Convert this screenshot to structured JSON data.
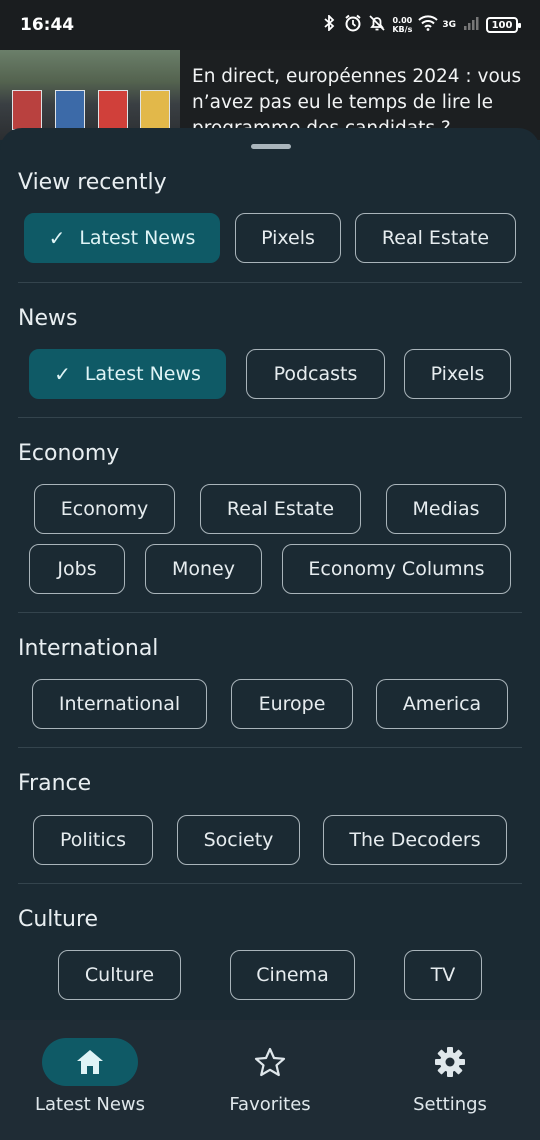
{
  "status_bar": {
    "time": "16:44",
    "speed_value": "0.00",
    "speed_unit": "KB/s",
    "network": "3G",
    "battery": "100"
  },
  "article": {
    "headline": "En direct, européennes 2024 : vous n’avez pas eu le temps de lire le programme des candidats ?"
  },
  "sections": [
    {
      "title": "View recently",
      "chips": [
        {
          "label": "Latest News",
          "selected": true
        },
        {
          "label": "Pixels",
          "selected": false
        },
        {
          "label": "Real Estate",
          "selected": false
        }
      ]
    },
    {
      "title": "News",
      "chips": [
        {
          "label": "Latest News",
          "selected": true
        },
        {
          "label": "Podcasts",
          "selected": false
        },
        {
          "label": "Pixels",
          "selected": false
        }
      ]
    },
    {
      "title": "Economy",
      "chips": [
        {
          "label": "Economy",
          "selected": false
        },
        {
          "label": "Real Estate",
          "selected": false
        },
        {
          "label": "Medias",
          "selected": false
        },
        {
          "label": "Jobs",
          "selected": false
        },
        {
          "label": "Money",
          "selected": false
        },
        {
          "label": "Economy Columns",
          "selected": false
        }
      ]
    },
    {
      "title": "International",
      "chips": [
        {
          "label": "International",
          "selected": false
        },
        {
          "label": "Europe",
          "selected": false
        },
        {
          "label": "America",
          "selected": false
        }
      ]
    },
    {
      "title": "France",
      "chips": [
        {
          "label": "Politics",
          "selected": false
        },
        {
          "label": "Society",
          "selected": false
        },
        {
          "label": "The Decoders",
          "selected": false
        }
      ]
    },
    {
      "title": "Culture",
      "chips": [
        {
          "label": "Culture",
          "selected": false
        },
        {
          "label": "Cinema",
          "selected": false
        },
        {
          "label": "TV",
          "selected": false
        }
      ]
    }
  ],
  "bottom_nav": [
    {
      "label": "Latest News",
      "icon": "home-icon",
      "active": true
    },
    {
      "label": "Favorites",
      "icon": "star-icon",
      "active": false
    },
    {
      "label": "Settings",
      "icon": "gear-icon",
      "active": false
    }
  ],
  "colors": {
    "background": "#1b2a33",
    "accent": "#0f5a66",
    "chip_border": "#a9b4ba"
  }
}
